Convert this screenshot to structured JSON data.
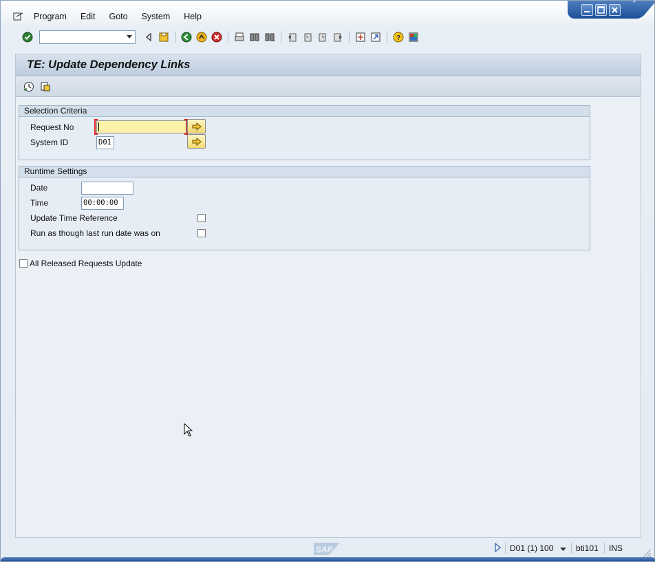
{
  "window": {
    "controls": {
      "minimize_icon": "minimize-icon",
      "maximize_icon": "maximize-icon",
      "close_icon": "close-icon"
    }
  },
  "menu": {
    "items": [
      {
        "label": "Program"
      },
      {
        "label": "Edit"
      },
      {
        "label": "Goto"
      },
      {
        "label": "System"
      },
      {
        "label": "Help"
      }
    ]
  },
  "toolbar": {
    "command_field_value": ""
  },
  "screen": {
    "title": "TE: Update Dependency Links"
  },
  "selection_criteria": {
    "title": "Selection Criteria",
    "request_no_label": "Request No",
    "request_no_value": "",
    "system_id_label": "System ID",
    "system_id_value": "D01"
  },
  "runtime_settings": {
    "title": "Runtime Settings",
    "date_label": "Date",
    "date_value": "",
    "time_label": "Time",
    "time_value": "00:00:00",
    "update_time_ref_label": "Update Time Reference",
    "update_time_ref_checked": false,
    "run_as_though_label": "Run as though last run date was on",
    "run_as_though_checked": false
  },
  "all_released": {
    "label": "All Released Requests Update",
    "checked": false
  },
  "status": {
    "system": "D01 (1) 100",
    "user": "bti101",
    "mode": "INS",
    "logo_text": "SAP"
  },
  "colors": {
    "accent": "#1c4f95",
    "focus_field": "#fcf1a8",
    "required_marker": "#d22222"
  }
}
